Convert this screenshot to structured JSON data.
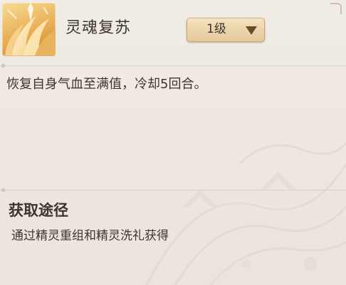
{
  "skill": {
    "name": "灵魂复苏",
    "icon": "wing-feather-icon",
    "description": "恢复自身气血至满值，冷却5回合。"
  },
  "level_selector": {
    "selected": "1级"
  },
  "acquire": {
    "title": "获取途径",
    "text": "通过精灵重组和精灵洗礼获得"
  },
  "colors": {
    "panel_bg": "#efe9e3",
    "text": "#3d352f",
    "icon_gold": "#e9ad52",
    "selector_bg": "#ecd4a8",
    "arrow": "#6a4c2c"
  }
}
